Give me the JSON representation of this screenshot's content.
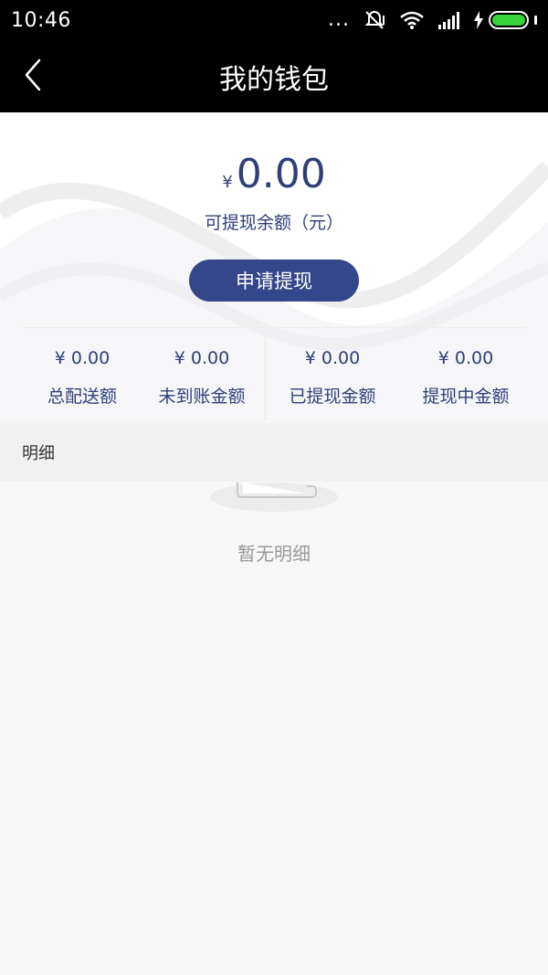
{
  "status_bar": {
    "time": "10:46",
    "more_dots": "...",
    "icons": [
      "mute-icon",
      "wifi-icon",
      "signal-icon",
      "charging-icon",
      "battery-icon"
    ],
    "battery_color": "#36d33b"
  },
  "nav": {
    "back_icon": "chevron-left-icon",
    "title": "我的钱包"
  },
  "balance": {
    "currency": "¥",
    "amount": "0.00",
    "label": "可提现余额（元）"
  },
  "withdraw_button": {
    "label": "申请提现",
    "color": "#33478a"
  },
  "stats": [
    {
      "value": "¥ 0.00",
      "label": "总配送额"
    },
    {
      "value": "¥ 0.00",
      "label": "未到账金额"
    },
    {
      "value": "¥ 0.00",
      "label": "已提现金额"
    },
    {
      "value": "¥ 0.00",
      "label": "提现中金额"
    }
  ],
  "details": {
    "header": "明细",
    "empty_icon": "empty-document-icon",
    "empty_text": "暂无明细"
  },
  "colors": {
    "accent": "#2f3f79",
    "navbar": "#000000"
  }
}
